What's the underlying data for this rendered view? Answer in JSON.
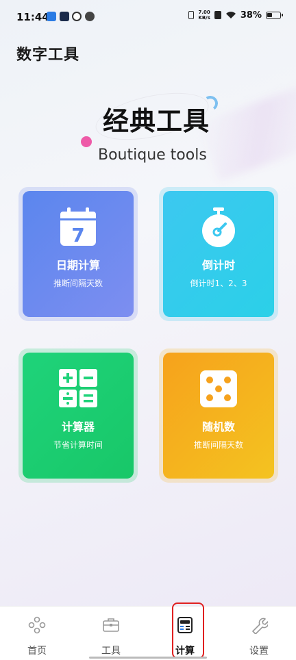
{
  "status_bar": {
    "time": "11:44",
    "net_speed_value": "7.00",
    "net_speed_unit": "KB/s",
    "battery": "38%"
  },
  "page_title": "数字工具",
  "hero": {
    "title": "经典工具",
    "subtitle": "Boutique tools"
  },
  "tools": [
    {
      "title": "日期计算",
      "subtitle": "推断间隔天数",
      "icon": "calendar-icon",
      "icon_text": "7"
    },
    {
      "title": "倒计时",
      "subtitle": "倒计时1、2、3",
      "icon": "stopwatch-icon"
    },
    {
      "title": "计算器",
      "subtitle": "节省计算时间",
      "icon": "calculator-icon"
    },
    {
      "title": "随机数",
      "subtitle": "推断间隔天数",
      "icon": "dice-icon"
    }
  ],
  "nav": [
    {
      "label": "首页",
      "icon": "home-dots-icon"
    },
    {
      "label": "工具",
      "icon": "toolbox-icon"
    },
    {
      "label": "计算",
      "icon": "calculator-icon"
    },
    {
      "label": "设置",
      "icon": "wrench-icon"
    }
  ],
  "colors": {
    "date_card": "#5b86ee",
    "countdown_card": "#3cc8f0",
    "calculator_card": "#1fd37a",
    "random_card": "#f6a21c",
    "highlight": "#e02020"
  }
}
